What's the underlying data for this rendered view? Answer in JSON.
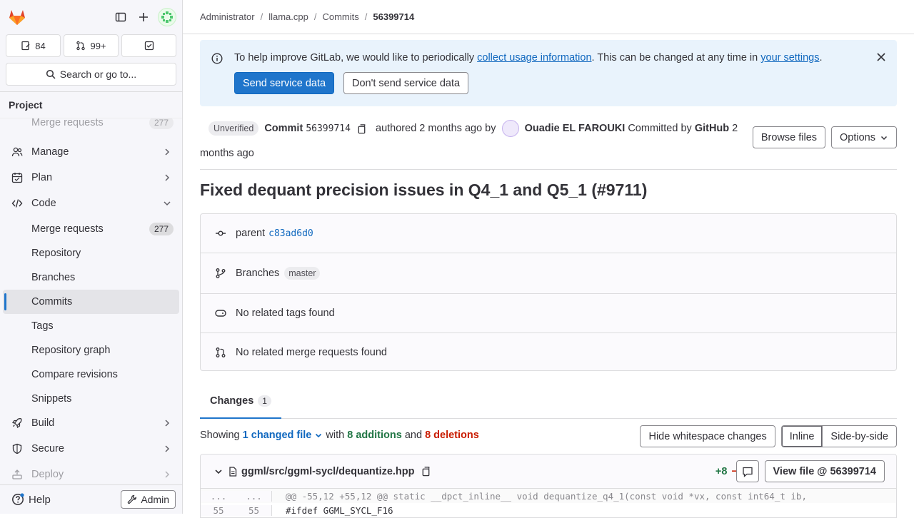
{
  "sidebar": {
    "counts": {
      "issues": "84",
      "merge_requests": "99+"
    },
    "search_label": "Search or go to...",
    "section_title": "Project",
    "nav": {
      "faded_top": {
        "label": "Merge requests",
        "badge": "277"
      },
      "manage": "Manage",
      "plan": "Plan",
      "code": "Code",
      "code_items": [
        {
          "label": "Merge requests",
          "badge": "277"
        },
        {
          "label": "Repository"
        },
        {
          "label": "Branches"
        },
        {
          "label": "Commits"
        },
        {
          "label": "Tags"
        },
        {
          "label": "Repository graph"
        },
        {
          "label": "Compare revisions"
        },
        {
          "label": "Snippets"
        }
      ],
      "build": "Build",
      "secure": "Secure",
      "deploy": "Deploy"
    },
    "help": "Help",
    "admin": "Admin"
  },
  "breadcrumb": [
    "Administrator",
    "llama.cpp",
    "Commits",
    "56399714"
  ],
  "alert": {
    "text_before": "To help improve GitLab, we would like to periodically ",
    "link1": "collect usage information",
    "text_middle": ". This can be changed at any time in ",
    "link2": "your settings",
    "text_after": ".",
    "send": "Send service data",
    "dont_send": "Don't send service data"
  },
  "commit": {
    "unverified": "Unverified",
    "commit_word": "Commit",
    "sha": "56399714",
    "authored": "authored 2 months ago by",
    "author": "Ouadie EL FAROUKI",
    "committed_by": "Committed by",
    "committer": "GitHub",
    "committed_time": "2 months ago",
    "browse_files": "Browse files",
    "options": "Options",
    "title": "Fixed dequant precision issues in Q4_1 and Q5_1 (#9711)",
    "parent_label": "parent",
    "parent_sha": "c83ad6d0",
    "branches_label": "Branches",
    "branch": "master",
    "tags_text": "No related tags found",
    "mrs_text": "No related merge requests found"
  },
  "changes": {
    "tab_label": "Changes",
    "tab_count": "1",
    "showing": "Showing",
    "changed_files": "1 changed file",
    "with": "with",
    "additions": "8 additions",
    "and": "and",
    "deletions": "8 deletions",
    "hide_ws": "Hide whitespace changes",
    "inline": "Inline",
    "side_by_side": "Side-by-side"
  },
  "file": {
    "path": "ggml/src/ggml-sycl/dequantize.hpp",
    "plus": "+8",
    "minus": "−8",
    "view_file": "View file @ 56399714",
    "lines": [
      {
        "old": "...",
        "new": "...",
        "code": "@@ -55,12 +55,12 @@ static __dpct_inline__ void dequantize_q4_1(const void *vx, const int64_t ib,"
      },
      {
        "old": "55",
        "new": "55",
        "code": "#ifdef GGML_SYCL_F16"
      }
    ]
  },
  "colors": {
    "accent": "#1f75cb",
    "additions": "#217645",
    "deletions": "#c91c00"
  }
}
